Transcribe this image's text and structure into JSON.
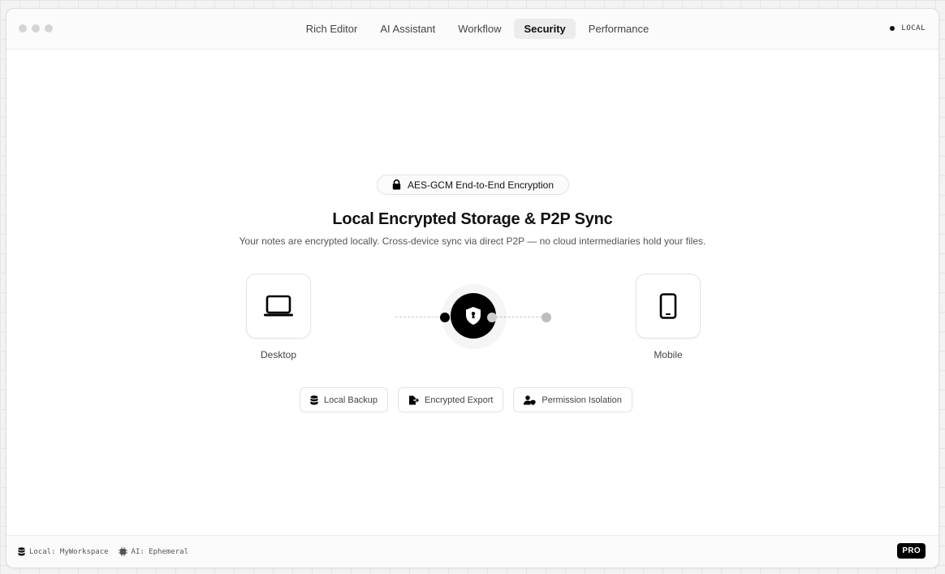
{
  "window": {
    "tabs": [
      {
        "label": "Rich Editor",
        "active": false
      },
      {
        "label": "AI Assistant",
        "active": false
      },
      {
        "label": "Workflow",
        "active": false
      },
      {
        "label": "Security",
        "active": true
      },
      {
        "label": "Performance",
        "active": false
      }
    ],
    "status_label": "LOCAL"
  },
  "hero": {
    "badge_label": "AES-GCM End-to-End Encryption",
    "badge_icon": "lock-icon",
    "title": "Local Encrypted Storage & P2P Sync",
    "subtitle": "Your notes are encrypted locally. Cross-device sync via direct P2P — no cloud intermediaries hold your files."
  },
  "sync_diagram": {
    "left_device": {
      "label": "Desktop",
      "icon": "laptop-icon"
    },
    "center": {
      "icon": "shield-icon"
    },
    "right_device": {
      "label": "Mobile",
      "icon": "smartphone-icon"
    }
  },
  "features": [
    {
      "label": "Local Backup",
      "icon": "database-icon"
    },
    {
      "label": "Encrypted Export",
      "icon": "file-export-icon"
    },
    {
      "label": "Permission Isolation",
      "icon": "user-shield-icon"
    }
  ],
  "footer": {
    "workspace": "Local: MyWorkspace",
    "ai_mode": "AI: Ephemeral",
    "plan_badge": "PRO"
  },
  "colors": {
    "accent": "#000000",
    "muted_text": "#555555",
    "border": "#e2e2e2",
    "background": "#ffffff"
  }
}
